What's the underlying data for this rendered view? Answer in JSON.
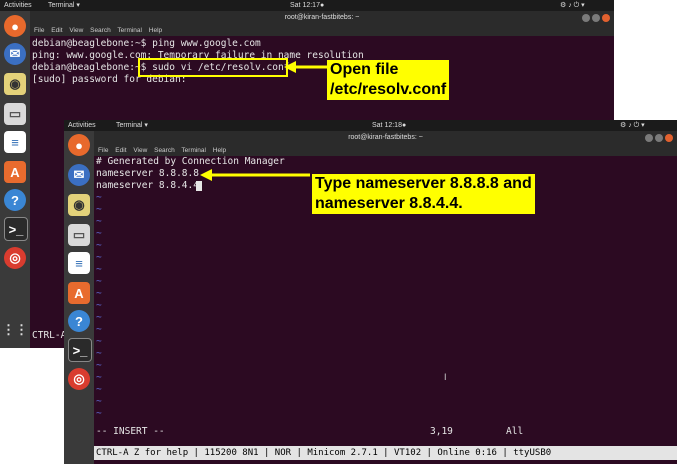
{
  "screen1": {
    "topbar": {
      "activities": "Activities",
      "app": "Terminal ▾",
      "clock": "Sat 12:17●",
      "tray": "⚙  ♪  ⏻ ▾"
    },
    "window_title": "root@kiran-fastbitebs: ~",
    "menu": [
      "File",
      "Edit",
      "View",
      "Search",
      "Terminal",
      "Help"
    ],
    "lines": [
      "debian@beaglebone:~$ ping www.google.com",
      "ping: www.google.com: Temporary failure in name resolution",
      "debian@beaglebone:~$ sudo vi /etc/resolv.conf",
      "[sudo] password for debian:"
    ],
    "bottom_text": "CTRL-A"
  },
  "screen2": {
    "topbar": {
      "activities": "Activities",
      "app": "Terminal ▾",
      "clock": "Sat 12:18●",
      "tray": "⚙  ♪  ⏻ ▾"
    },
    "window_title": "root@kiran-fastbitebs: ~",
    "menu": [
      "File",
      "Edit",
      "View",
      "Search",
      "Terminal",
      "Help"
    ],
    "lines": [
      "# Generated by Connection Manager",
      "nameserver 8.8.8.8",
      "nameserver 8.8.4.4"
    ],
    "tilde": "~",
    "mode": "-- INSERT --",
    "position": "3,19",
    "scroll": "All",
    "status_bar": "CTRL-A Z for help | 115200 8N1 | NOR | Minicom 2.7.1 | VT102 | Online 0:16 | ttyUSB0"
  },
  "annotations": {
    "open_file": [
      "Open file",
      "/etc/resolv.conf"
    ],
    "type_ns": [
      "Type nameserver 8.8.8.8 and",
      "nameserver 8.8.4.4."
    ]
  },
  "dock_icons": [
    "firefox-icon",
    "thunderbird-icon",
    "rhythmbox-icon",
    "files-icon",
    "document-icon",
    "software-center-icon",
    "help-icon",
    "terminal-icon",
    "chrome-icon",
    "apps-grid-icon"
  ],
  "colors": {
    "terminal_bg": "#2c0a22",
    "highlight": "#ffff00",
    "tilde": "#5f6bd6"
  }
}
